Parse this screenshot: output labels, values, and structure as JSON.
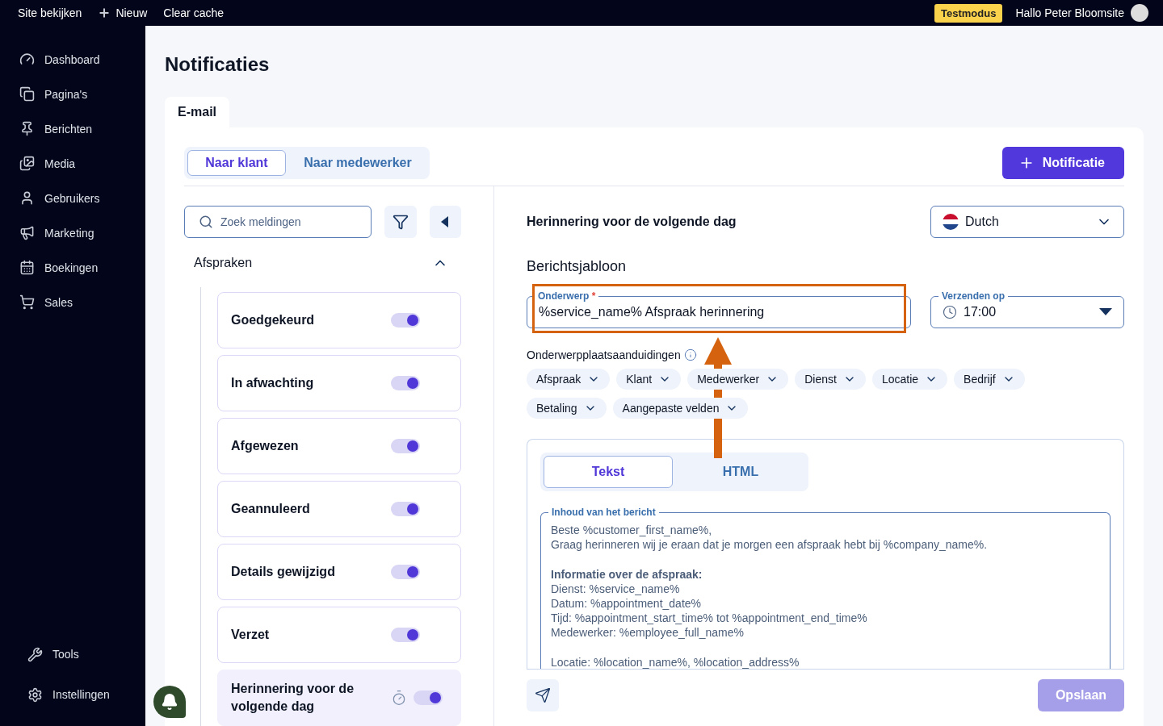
{
  "topbar": {
    "links": [
      {
        "label": "Site bekijken",
        "kind": "text"
      },
      {
        "label": "Nieuw",
        "kind": "add"
      },
      {
        "label": "Clear cache",
        "kind": "text"
      }
    ],
    "badge": "Testmodus",
    "greeting": "Hallo Peter Bloomsite"
  },
  "sidebar": {
    "items": [
      {
        "label": "Dashboard"
      },
      {
        "label": "Pagina's"
      },
      {
        "label": "Berichten"
      },
      {
        "label": "Media"
      },
      {
        "label": "Gebruikers"
      },
      {
        "label": "Marketing"
      },
      {
        "label": "Boekingen"
      },
      {
        "label": "Sales"
      }
    ],
    "bottom_items": [
      {
        "label": "Tools"
      },
      {
        "label": "Instellingen"
      }
    ]
  },
  "page": {
    "title": "Notificaties",
    "tabs": [
      {
        "label": "E-mail",
        "selected": true
      }
    ]
  },
  "recipient_tabs": [
    {
      "label": "Naar klant",
      "selected": true
    },
    {
      "label": "Naar medewerker",
      "selected": false
    }
  ],
  "add_button": "Notificatie",
  "list": {
    "search": {
      "placeholder": "Zoek meldingen"
    },
    "group": {
      "label": "Afspraken",
      "expanded": true
    },
    "items": [
      {
        "label": "Goedgekeurd",
        "on": true,
        "selected": false,
        "scheduled": false
      },
      {
        "label": "In afwachting",
        "on": true,
        "selected": false,
        "scheduled": false
      },
      {
        "label": "Afgewezen",
        "on": true,
        "selected": false,
        "scheduled": false
      },
      {
        "label": "Geannuleerd",
        "on": true,
        "selected": false,
        "scheduled": false
      },
      {
        "label": "Details gewijzigd",
        "on": true,
        "selected": false,
        "scheduled": false
      },
      {
        "label": "Verzet",
        "on": true,
        "selected": false,
        "scheduled": false
      },
      {
        "label": "Herinnering voor de volgende dag",
        "on": true,
        "selected": true,
        "scheduled": true
      }
    ]
  },
  "detail": {
    "title": "Herinnering voor de volgende dag",
    "language": "Dutch",
    "section": "Berichtsjabloon",
    "subject": {
      "label": "Onderwerp",
      "required_mark": "*",
      "value": "%service_name% Afspraak herinnering"
    },
    "send_at": {
      "label": "Verzenden op",
      "value": "17:00"
    },
    "placeholders_label": "Onderwerpplaatsaanduidingen",
    "placeholder_chips": [
      "Afspraak",
      "Klant",
      "Medewerker",
      "Dienst",
      "Locatie",
      "Bedrijf",
      "Betaling",
      "Aangepaste velden"
    ],
    "editor_tabs": [
      {
        "label": "Tekst",
        "selected": true
      },
      {
        "label": "HTML",
        "selected": false
      }
    ],
    "body": {
      "label": "Inhoud van het bericht",
      "paragraphs": [
        [
          "Beste %customer_first_name%,",
          "Graag herinneren wij je eraan dat je morgen een afspraak hebt bij %company_name%."
        ],
        [
          "**Informatie over de afspraak:**",
          "Dienst: %service_name%",
          "Datum: %appointment_date%",
          "Tijd: %appointment_start_time% tot %appointment_end_time%",
          "Medewerker: %employee_full_name%"
        ],
        [
          "Locatie: %location_name%, %location_address%"
        ]
      ]
    },
    "save_button": {
      "label": "Opslaan",
      "disabled": true
    }
  }
}
